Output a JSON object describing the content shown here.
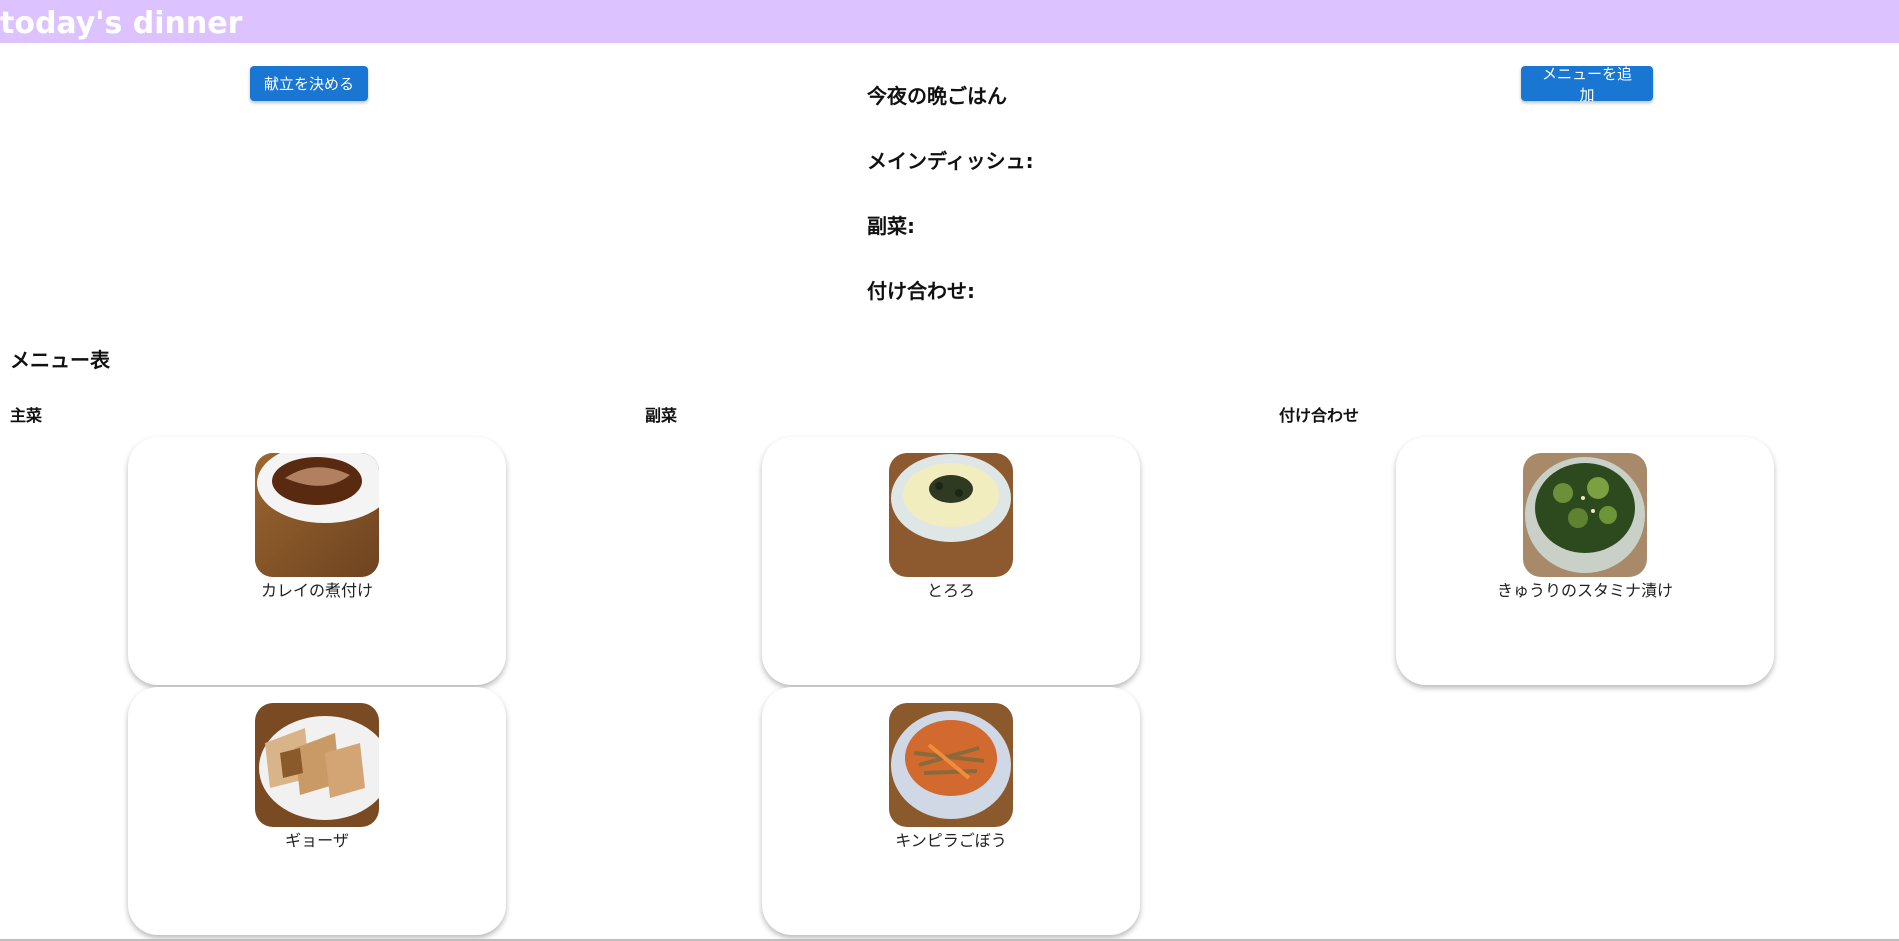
{
  "header": {
    "title": "today's dinner",
    "bg_color": "#dcc3ff"
  },
  "buttons": {
    "decide_label": "献立を決める",
    "add_label": "メニューを追加",
    "color": "#1976d2"
  },
  "tonight": {
    "title": "今夜の晩ごはん",
    "main_label": "メインディッシュ:",
    "side_label": "副菜:",
    "garnish_label": "付け合わせ:"
  },
  "menu": {
    "title": "メニュー表",
    "columns": [
      {
        "header": "主菜",
        "items": [
          {
            "name": "カレイの煮付け",
            "image": "simmered-flounder-photo"
          },
          {
            "name": "ギョーザ",
            "image": "gyoza-photo"
          }
        ]
      },
      {
        "header": "副菜",
        "items": [
          {
            "name": "とろろ",
            "image": "tororo-photo"
          },
          {
            "name": "キンピラごぼう",
            "image": "kinpira-gobo-photo"
          }
        ]
      },
      {
        "header": "付け合わせ",
        "items": [
          {
            "name": "きゅうりのスタミナ漬け",
            "image": "cucumber-pickle-photo"
          }
        ]
      }
    ]
  }
}
